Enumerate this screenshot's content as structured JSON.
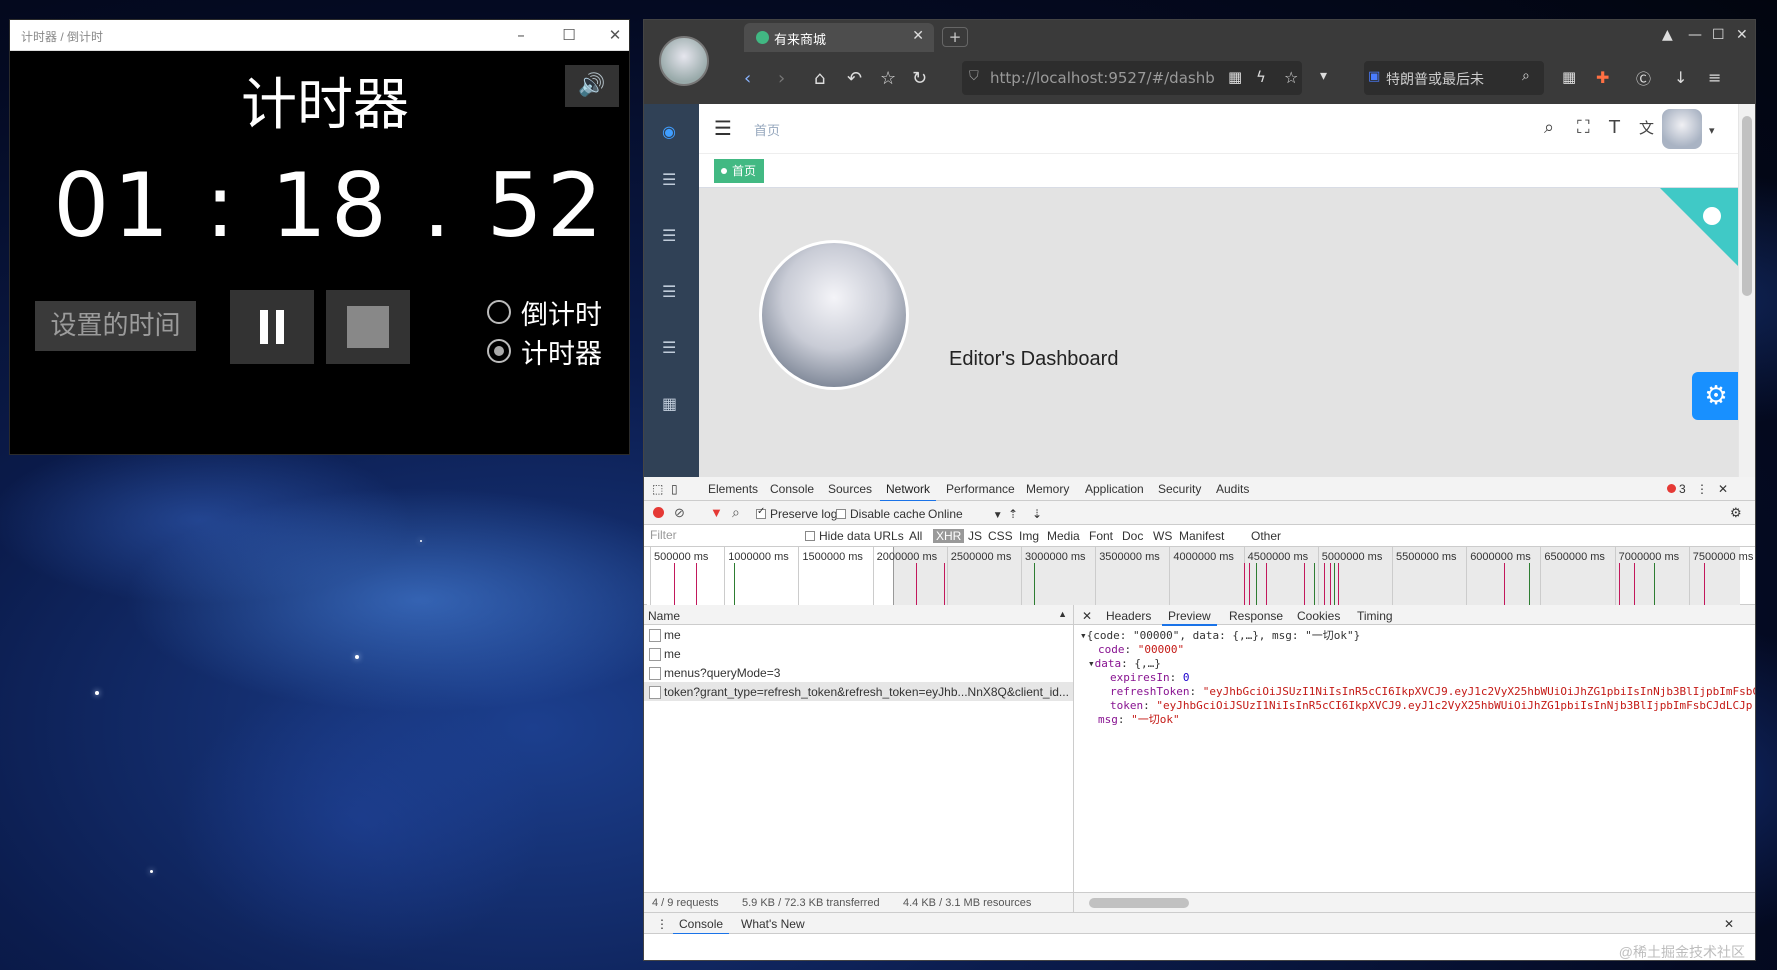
{
  "desktop": {
    "watermark": "@稀土掘金技术社区"
  },
  "timer_window": {
    "title": "计时器 / 倒计时",
    "heading": "计时器",
    "display": "01 : 18 . 52",
    "set_time_label": "设置的时间",
    "radio_options": [
      {
        "label": "倒计时",
        "checked": false
      },
      {
        "label": "计时器",
        "checked": true
      }
    ]
  },
  "browser": {
    "tab_title": "有来商城",
    "url": "http://localhost:9527/#/dashb",
    "search_text": "特朗普或最后未",
    "app": {
      "breadcrumb": "首页",
      "tag_active": "首页",
      "dashboard_title": "Editor's Dashboard"
    }
  },
  "devtools": {
    "tabs": [
      "Elements",
      "Console",
      "Sources",
      "Network",
      "Performance",
      "Memory",
      "Application",
      "Security",
      "Audits"
    ],
    "active_tab": "Network",
    "error_count": "3",
    "toolbar": {
      "preserve_log": "Preserve log",
      "disable_cache": "Disable cache",
      "throttling": "Online"
    },
    "filter": {
      "placeholder": "Filter",
      "hide_data_urls": "Hide data URLs",
      "types": [
        "All",
        "XHR",
        "JS",
        "CSS",
        "Img",
        "Media",
        "Font",
        "Doc",
        "WS",
        "Manifest",
        "Other"
      ],
      "selected_type": "XHR"
    },
    "overview_ticks": [
      "500000 ms",
      "1000000 ms",
      "1500000 ms",
      "2000000 ms",
      "2500000 ms",
      "3000000 ms",
      "3500000 ms",
      "4000000 ms",
      "4500000 ms",
      "5000000 ms",
      "5500000 ms",
      "6000000 ms",
      "6500000 ms",
      "7000000 ms",
      "7500000 ms"
    ],
    "request_list": {
      "header": "Name",
      "rows": [
        "me",
        "me",
        "menus?queryMode=3",
        "token?grant_type=refresh_token&refresh_token=eyJhb...NnX8Q&client_id..."
      ],
      "selected_index": 3
    },
    "preview_tabs": [
      "Headers",
      "Preview",
      "Response",
      "Cookies",
      "Timing"
    ],
    "active_preview_tab": "Preview",
    "preview_json": {
      "summary": "{code: \"00000\", data: {,…}, msg: \"一切ok\"}",
      "code": "\"00000\"",
      "data_summary": "{,…}",
      "expiresIn": "0",
      "refreshToken": "\"eyJhbGciOiJSUzI1NiIsInR5cCI6IkpXVCJ9.eyJ1c2VyX25hbWUiOiJhZG1pbiIsInNjb3BlIjpbImFsbC",
      "token": "\"eyJhbGciOiJSUzI1NiIsInR5cCI6IkpXVCJ9.eyJ1c2VyX25hbWUiOiJhZG1pbiIsInNjb3BlIjpbImFsbCJdLCJp",
      "msg": "\"一切ok\""
    },
    "status": {
      "requests": "4 / 9 requests",
      "transferred": "5.9 KB / 72.3 KB transferred",
      "resources": "4.4 KB / 3.1 MB resources"
    },
    "drawer_tabs": [
      "Console",
      "What's New"
    ]
  }
}
